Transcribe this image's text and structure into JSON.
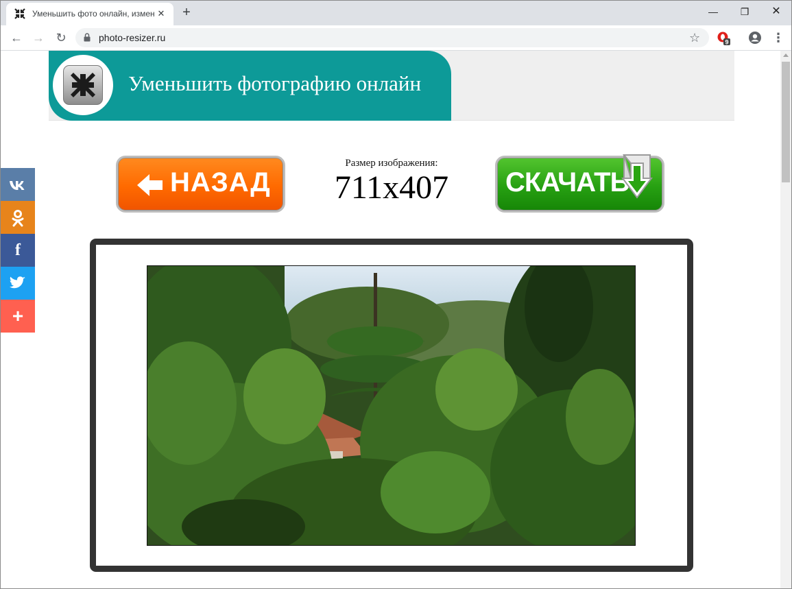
{
  "browser": {
    "tab_title": "Уменьшить фото онлайн, изменить размер",
    "tab_close": "✕",
    "new_tab": "+",
    "url": "photo-resizer.ru",
    "extension_badge": "9",
    "window_controls": {
      "minimize": "—",
      "restore": "❐",
      "close": "✕"
    }
  },
  "header": {
    "title": "Уменьшить фотографию онлайн"
  },
  "actions": {
    "back_label": "НАЗАД",
    "download_label": "СКАЧАТЬ"
  },
  "image_info": {
    "label": "Размер изображения:",
    "size": "711x407"
  },
  "social": {
    "vk": "vk",
    "ok": "ok",
    "facebook": "f",
    "twitter": "twitter",
    "more": "+"
  },
  "colors": {
    "header_teal": "#0d9a98",
    "back_button": "#ff6a00",
    "download_button": "#27a012",
    "frame": "#333333"
  }
}
